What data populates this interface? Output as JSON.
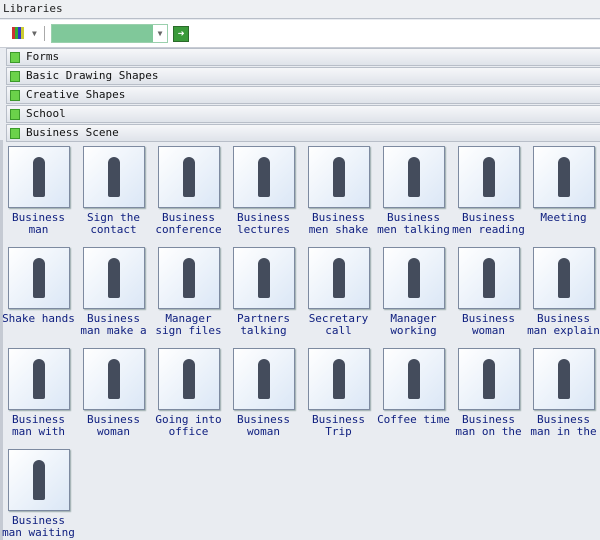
{
  "title": "Libraries",
  "toolbar": {
    "library_icon": "library-books-icon",
    "search_value": "",
    "go_icon": "arrow-right-icon"
  },
  "categories": [
    "Forms",
    "Basic Drawing Shapes",
    "Creative Shapes",
    "School",
    "Business Scene"
  ],
  "items": [
    "Business man",
    "Sign the contact",
    "Business conference",
    "Business lectures",
    "Business men shake",
    "Business men talking",
    "Business men reading",
    "Meeting",
    "Shake hands",
    "Business man make a",
    "Manager sign files",
    "Partners talking",
    "Secretary call",
    "Manager working",
    "Business woman",
    "Business man explain",
    "Business man with",
    "Business woman",
    "Going into office",
    "Business woman",
    "Business Trip",
    "Coffee time",
    "Business man on the",
    "Business man in the",
    "Business man waiting"
  ]
}
